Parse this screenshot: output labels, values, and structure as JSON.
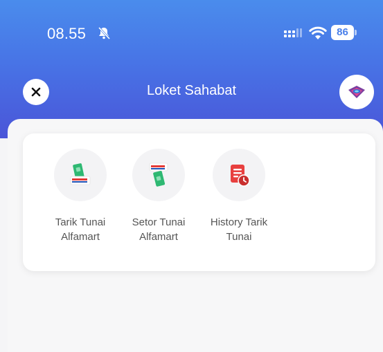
{
  "status_bar": {
    "time": "08.55",
    "battery": "86"
  },
  "nav": {
    "title": "Loket Sahabat"
  },
  "menu": {
    "items": [
      {
        "line1": "Tarik Tunai",
        "line2": "Alfamart",
        "icon": "cash-withdrawal-alfamart-icon"
      },
      {
        "line1": "Setor Tunai",
        "line2": "Alfamart",
        "icon": "cash-deposit-alfamart-icon"
      },
      {
        "line1": "History Tarik",
        "line2": "Tunai",
        "icon": "withdrawal-history-icon"
      }
    ]
  },
  "colors": {
    "header_top": "#4a8cec",
    "header_bottom": "#4a55d8",
    "alfamart_red": "#e53935",
    "money_green": "#2eb872",
    "history_red": "#e8403f"
  }
}
